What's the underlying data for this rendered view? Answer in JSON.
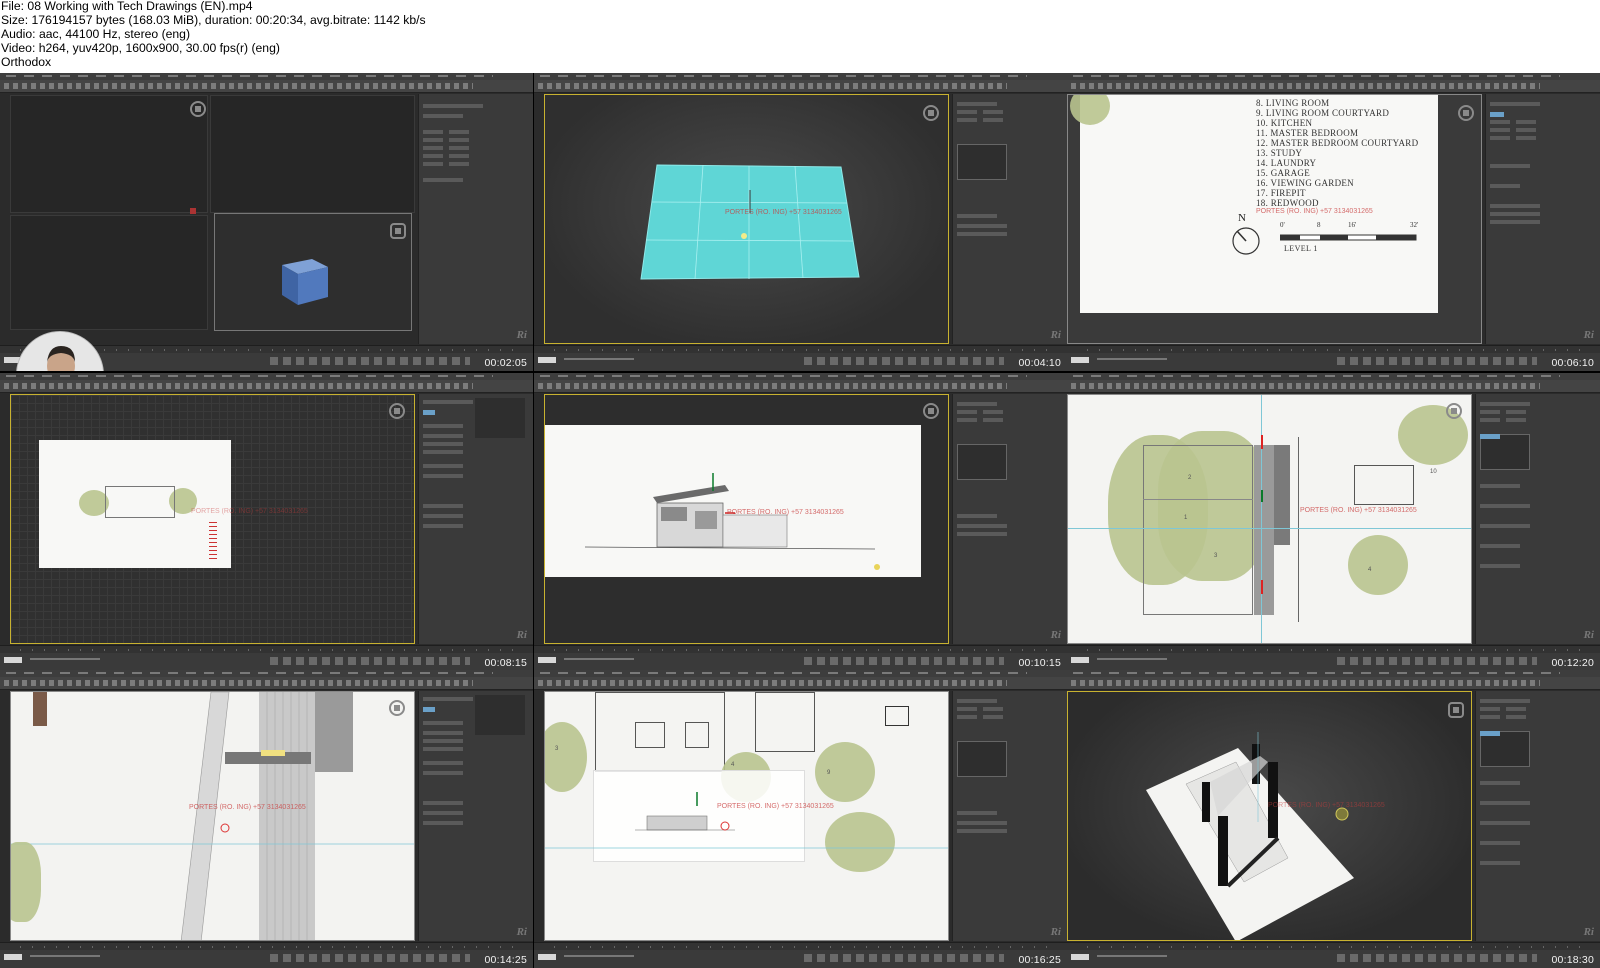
{
  "header": {
    "lines": [
      "File: 08 Working with Tech Drawings (EN).mp4",
      "Size: 176194157 bytes (168.03 MiB), duration: 00:20:34, avg.bitrate: 1142 kb/s",
      "Audio: aac, 44100 Hz, stereo (eng)",
      "Video: h264, yuv420p, 1600x900, 30.00 fps(r) (eng)",
      "Orthodox"
    ]
  },
  "thumbnails": [
    {
      "timestamp": "00:02:05"
    },
    {
      "timestamp": "00:04:10"
    },
    {
      "timestamp": "00:06:10"
    },
    {
      "timestamp": "00:08:15"
    },
    {
      "timestamp": "00:10:15"
    },
    {
      "timestamp": "00:12:20"
    },
    {
      "timestamp": "00:14:25"
    },
    {
      "timestamp": "00:16:25"
    },
    {
      "timestamp": "00:18:30"
    }
  ],
  "brand_mark": "Ri",
  "watermark_text": "PORTES (RO. ING) +57 3134031265",
  "plan_legend": {
    "rooms": [
      "8.  LIVING ROOM",
      "9.  LIVING ROOM COURTYARD",
      "10. KITCHEN",
      "11. MASTER BEDROOM",
      "12. MASTER BEDROOM COURTYARD",
      "13. STUDY",
      "14. LAUNDRY",
      "15. GARAGE",
      "16. VIEWING GARDEN",
      "17. FIREPIT",
      "18. REDWOOD"
    ],
    "north_label": "N",
    "scale_ticks": [
      "0'",
      "8",
      "16'",
      "32'"
    ],
    "level_label": "LEVEL 1"
  },
  "plan_numbers": [
    "1",
    "2",
    "3",
    "4",
    "10",
    "9"
  ],
  "colors": {
    "viewport_border": "#c8b230",
    "plane_cyan": "#5fd6d6",
    "cube_blue": "#4b6fb0",
    "tree_green": "#b9c48f",
    "ui_dark": "#2b2b2b"
  }
}
